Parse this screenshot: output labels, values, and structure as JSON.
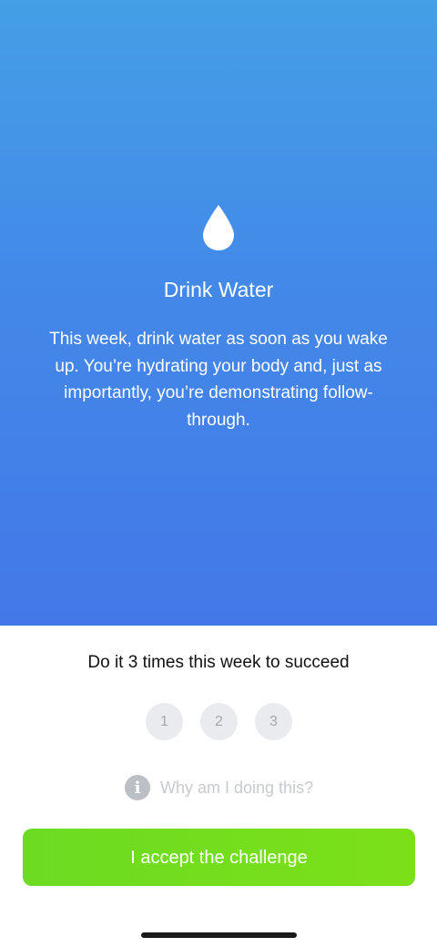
{
  "challenge": {
    "title": "Drink Water",
    "description": "This week, drink water as soon as you wake up. You’re hydrating your body and, just as importantly, you’re demonstrating follow-through.",
    "icon": "water-drop-icon",
    "colors": {
      "hero_top": "#449fe6",
      "hero_bottom": "#4378e8",
      "button": "#6cdb22"
    }
  },
  "goal": {
    "text": "Do it 3 times this week to succeed",
    "steps": [
      "1",
      "2",
      "3"
    ],
    "completed": 0
  },
  "why": {
    "icon": "info-icon",
    "label": "Why am I doing this?"
  },
  "accept_button": {
    "label": "I accept the challenge"
  }
}
